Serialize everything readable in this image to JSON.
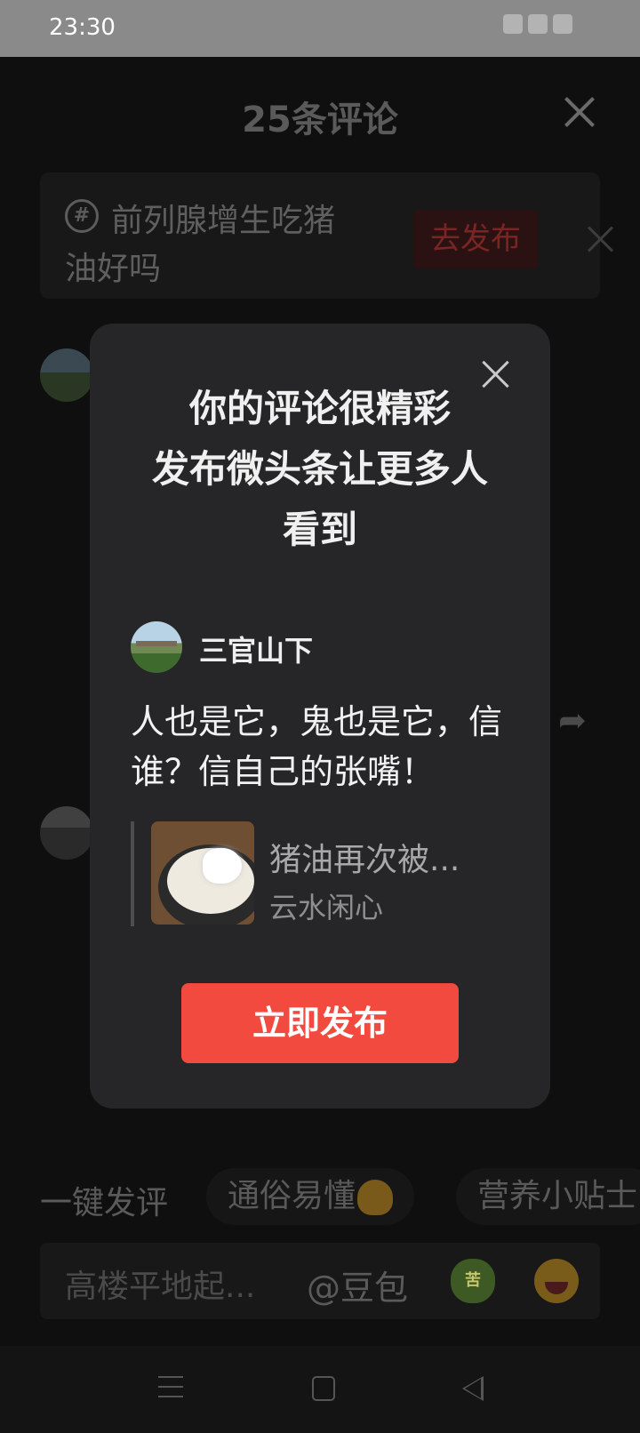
{
  "status_bar": {
    "time": "23:30"
  },
  "comment_sheet": {
    "title": "25条评论",
    "topic_prompt": {
      "text": "前列腺增生吃猪油好吗",
      "publish_label": "去发布",
      "icon": "hashtag-icon"
    },
    "quick_comment": {
      "label": "一键发评",
      "chips": [
        "通俗易懂",
        "营养小贴士"
      ]
    },
    "input": {
      "placeholder": "高楼平地起...",
      "mention": "@豆包",
      "emoji_bitter_text": "苦"
    }
  },
  "modal": {
    "title_lines": [
      "你的评论很精彩",
      "发布微头条让更多人",
      "看到"
    ],
    "author_name": "三官山下",
    "comment_text": "人也是它，鬼也是它，信谁？信自己的张嘴！",
    "quoted_article": {
      "title": "猪油再次被...",
      "author": "云水闲心"
    },
    "publish_button_label": "立即发布"
  },
  "colors": {
    "accent_red": "#f24a3e",
    "modal_bg": "#262628",
    "status_bar_bg": "#8a8a8a"
  }
}
